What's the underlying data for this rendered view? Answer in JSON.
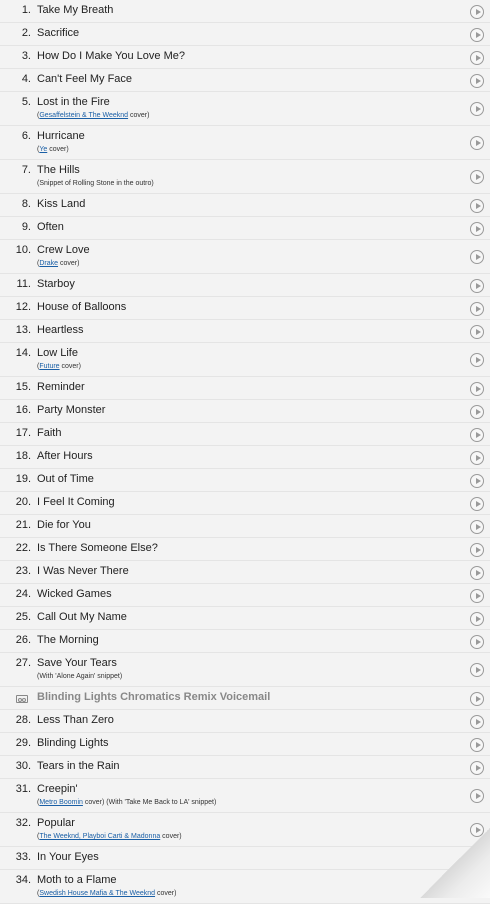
{
  "setlist": [
    {
      "number": "1.",
      "title": "Take My Breath"
    },
    {
      "number": "2.",
      "title": "Sacrifice"
    },
    {
      "number": "3.",
      "title": "How Do I Make You Love Me?"
    },
    {
      "number": "4.",
      "title": "Can't Feel My Face"
    },
    {
      "number": "5.",
      "title": "Lost in the Fire",
      "note_pre": "(",
      "note_link": "Gesaffelstein & The Weeknd",
      "note_post": " cover)"
    },
    {
      "number": "6.",
      "title": "Hurricane",
      "note_pre": "(",
      "note_link": "Ye",
      "note_post": " cover)"
    },
    {
      "number": "7.",
      "title": "The Hills",
      "note_pre": "(Snippet of Rolling Stone in the outro)",
      "note_link": "",
      "note_post": ""
    },
    {
      "number": "8.",
      "title": "Kiss Land"
    },
    {
      "number": "9.",
      "title": "Often"
    },
    {
      "number": "10.",
      "title": "Crew Love",
      "note_pre": "(",
      "note_link": "Drake",
      "note_post": " cover)"
    },
    {
      "number": "11.",
      "title": "Starboy"
    },
    {
      "number": "12.",
      "title": "House of Balloons"
    },
    {
      "number": "13.",
      "title": "Heartless"
    },
    {
      "number": "14.",
      "title": "Low Life",
      "note_pre": "(",
      "note_link": "Future",
      "note_post": " cover)"
    },
    {
      "number": "15.",
      "title": "Reminder"
    },
    {
      "number": "16.",
      "title": "Party Monster"
    },
    {
      "number": "17.",
      "title": "Faith"
    },
    {
      "number": "18.",
      "title": "After Hours"
    },
    {
      "number": "19.",
      "title": "Out of Time"
    },
    {
      "number": "20.",
      "title": "I Feel It Coming"
    },
    {
      "number": "21.",
      "title": "Die for You"
    },
    {
      "number": "22.",
      "title": "Is There Someone Else?"
    },
    {
      "number": "23.",
      "title": "I Was Never There"
    },
    {
      "number": "24.",
      "title": "Wicked Games"
    },
    {
      "number": "25.",
      "title": "Call Out My Name"
    },
    {
      "number": "26.",
      "title": "The Morning"
    },
    {
      "number": "27.",
      "title": "Save Your Tears",
      "note_pre": "(With 'Alone Again' snippet)",
      "note_link": "",
      "note_post": ""
    },
    {
      "tape": true,
      "title": "Blinding Lights Chromatics Remix Voicemail"
    },
    {
      "number": "28.",
      "title": "Less Than Zero"
    },
    {
      "number": "29.",
      "title": "Blinding Lights"
    },
    {
      "number": "30.",
      "title": "Tears in the Rain"
    },
    {
      "number": "31.",
      "title": "Creepin'",
      "note_pre": "(",
      "note_link": "Metro Boomin",
      "note_post": " cover) (With 'Take Me Back to LA' snippet)"
    },
    {
      "number": "32.",
      "title": "Popular",
      "note_pre": "(",
      "note_link": "The Weeknd, Playboi Carti & Madonna",
      "note_post": " cover)"
    },
    {
      "number": "33.",
      "title": "In Your Eyes"
    },
    {
      "number": "34.",
      "title": "Moth to a Flame",
      "note_pre": "(",
      "note_link": "Swedish House Mafia & The Weeknd",
      "note_post": " cover)"
    }
  ],
  "colors": {
    "link": "#1a5fa6",
    "text": "#222222",
    "tape": "#888888",
    "background": "#f3f3f3"
  },
  "icons": {
    "play": "play-circle-icon",
    "tape": "cassette-tape-icon"
  }
}
